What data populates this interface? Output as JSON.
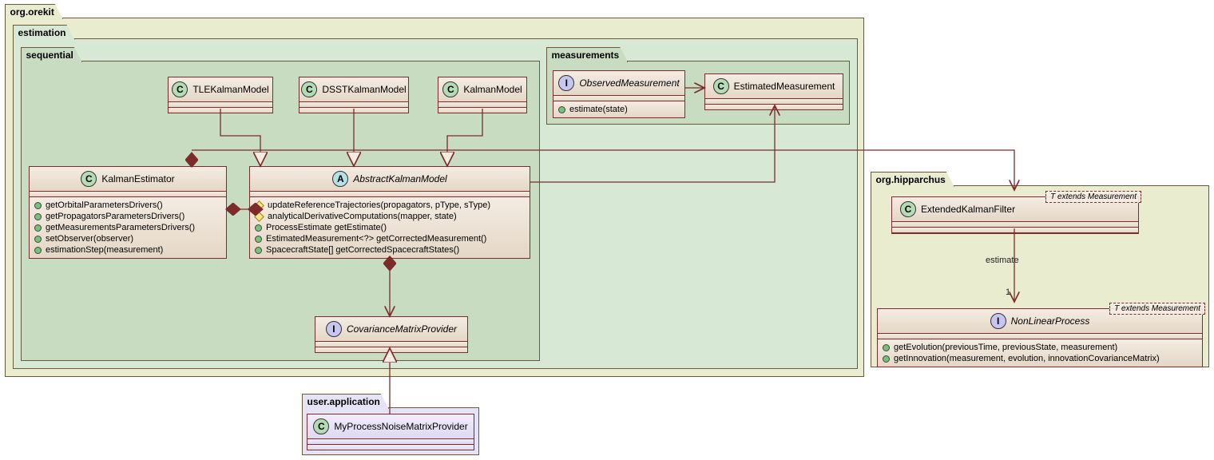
{
  "packages": {
    "orekit": "org.orekit",
    "estimation": "estimation",
    "sequential": "sequential",
    "measurements": "measurements",
    "hipparchus": "org.hipparchus",
    "userapp": "user.application"
  },
  "classes": {
    "TLEKalmanModel": {
      "name": "TLEKalmanModel",
      "stereo": "C"
    },
    "DSSTKalmanModel": {
      "name": "DSSTKalmanModel",
      "stereo": "C"
    },
    "KalmanModel": {
      "name": "KalmanModel",
      "stereo": "C"
    },
    "KalmanEstimator": {
      "name": "KalmanEstimator",
      "stereo": "C",
      "m0": "getOrbitalParametersDrivers()",
      "m1": "getPropagatorsParametersDrivers()",
      "m2": "getMeasurementsParametersDrivers()",
      "m3": "setObserver(observer)",
      "m4": "estimationStep(measurement)"
    },
    "AbstractKalmanModel": {
      "name": "AbstractKalmanModel",
      "stereo": "A",
      "m0": "updateReferenceTrajectories(propagators, pType, sType)",
      "m1": "analyticalDerivativeComputations(mapper, state)",
      "m2": "ProcessEstimate getEstimate()",
      "m3": "EstimatedMeasurement<?> getCorrectedMeasurement()",
      "m4": "SpacecraftState[] getCorrectedSpacecraftStates()"
    },
    "CovarianceMatrixProvider": {
      "name": "CovarianceMatrixProvider",
      "stereo": "I"
    },
    "ObservedMeasurement": {
      "name": "ObservedMeasurement",
      "stereo": "I",
      "m0": "estimate(state)"
    },
    "EstimatedMeasurement": {
      "name": "EstimatedMeasurement",
      "stereo": "C"
    },
    "ExtendedKalmanFilter": {
      "name": "ExtendedKalmanFilter",
      "stereo": "C",
      "tparam": "T extends Measurement"
    },
    "NonLinearProcess": {
      "name": "NonLinearProcess",
      "stereo": "I",
      "tparam": "T extends Measurement",
      "m0": "getEvolution(previousTime, previousState, measurement)",
      "m1": "getInnovation(measurement, evolution, innovationCovarianceMatrix)"
    },
    "MyProcessNoiseMatrixProvider": {
      "name": "MyProcessNoiseMatrixProvider",
      "stereo": "C"
    }
  },
  "labels": {
    "estimate": "estimate",
    "one": "1"
  }
}
